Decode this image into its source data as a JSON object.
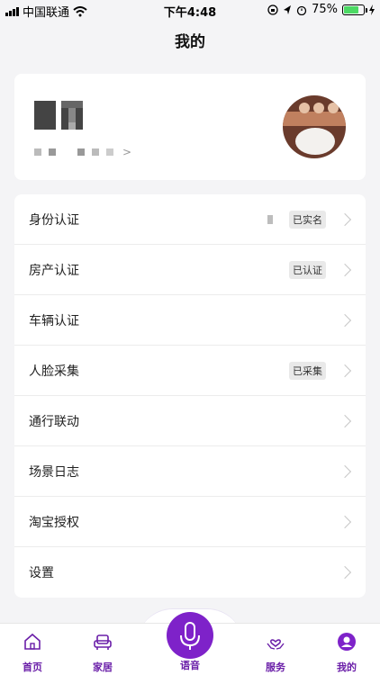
{
  "status_bar": {
    "carrier": "中国联通",
    "time": "下午4:48",
    "battery_text": "75%",
    "battery_level": 0.75
  },
  "header": {
    "title": "我的"
  },
  "profile": {
    "name_placeholder": "MT",
    "subtitle_arrow": ">"
  },
  "menu": {
    "items": [
      {
        "label": "身份认证",
        "tag": "已实名"
      },
      {
        "label": "房产认证",
        "tag": "已认证"
      },
      {
        "label": "车辆认证",
        "tag": ""
      },
      {
        "label": "人脸采集",
        "tag": "已采集"
      },
      {
        "label": "通行联动",
        "tag": ""
      },
      {
        "label": "场景日志",
        "tag": ""
      },
      {
        "label": "淘宝授权",
        "tag": ""
      },
      {
        "label": "设置",
        "tag": ""
      }
    ]
  },
  "tabbar": {
    "home": "首页",
    "family": "家居",
    "voice": "语音",
    "service": "服务",
    "mine": "我的"
  },
  "colors": {
    "accent": "#7e22c9",
    "tab_text": "#6a1ea8"
  }
}
